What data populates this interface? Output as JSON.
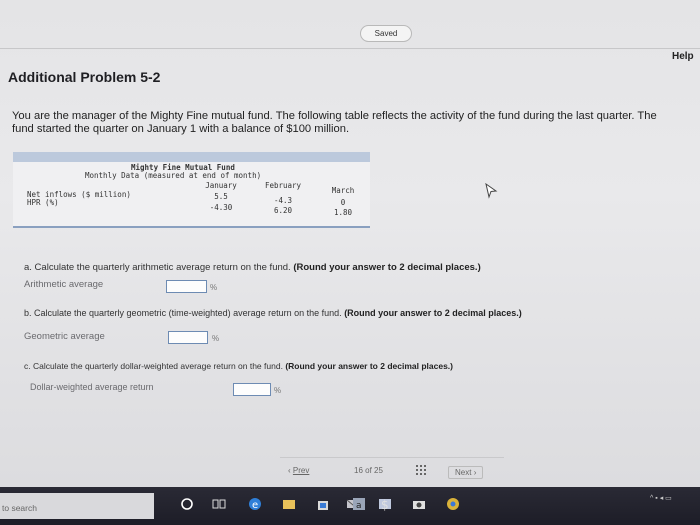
{
  "header": {
    "saved_label": "Saved",
    "help_label": "Help"
  },
  "problem": {
    "title": "Additional Problem 5-2",
    "intro_line1": "You are the manager of the Mighty Fine mutual fund. The following table reflects the activity of the fund during the last quarter. The",
    "intro_line2": "fund started the quarter on January 1 with a balance of $100 million."
  },
  "data_table": {
    "title": "Mighty Fine Mutual Fund",
    "subtitle": "Monthly Data (measured at end of month)",
    "columns": [
      "January",
      "February",
      "March"
    ],
    "rows": [
      {
        "label": "Net inflows ($ million)",
        "values": [
          "5.5",
          "-4.3",
          "0"
        ]
      },
      {
        "label": "HPR (%)",
        "values": [
          "-4.30",
          "6.20",
          "1.80"
        ]
      }
    ]
  },
  "questions": [
    {
      "prompt": "a. Calculate the quarterly arithmetic average return on the fund.",
      "hint": "(Round your answer to 2 decimal places.)",
      "answer_label": "Arithmetic average",
      "answer_value": "",
      "unit": "%"
    },
    {
      "prompt": "b. Calculate the quarterly geometric (time-weighted) average return on the fund.",
      "hint": "(Round your answer to 2 decimal places.)",
      "answer_label": "Geometric average",
      "answer_value": "",
      "unit": "%"
    },
    {
      "prompt": "c. Calculate the quarterly dollar-weighted average return on the fund.",
      "hint": "(Round your answer to 2 decimal places.)",
      "answer_label": "Dollar-weighted average return",
      "answer_value": "",
      "unit": "%"
    }
  ],
  "pagination": {
    "prev_label": "Prev",
    "current": "16",
    "of_label": "of",
    "total": "25",
    "next_label": "Next"
  },
  "taskbar": {
    "search_placeholder": "to search"
  },
  "colors": {
    "input_border": "#6d8bb3",
    "table_band": "#bcc9dc",
    "taskbar": "#1d1d27"
  }
}
